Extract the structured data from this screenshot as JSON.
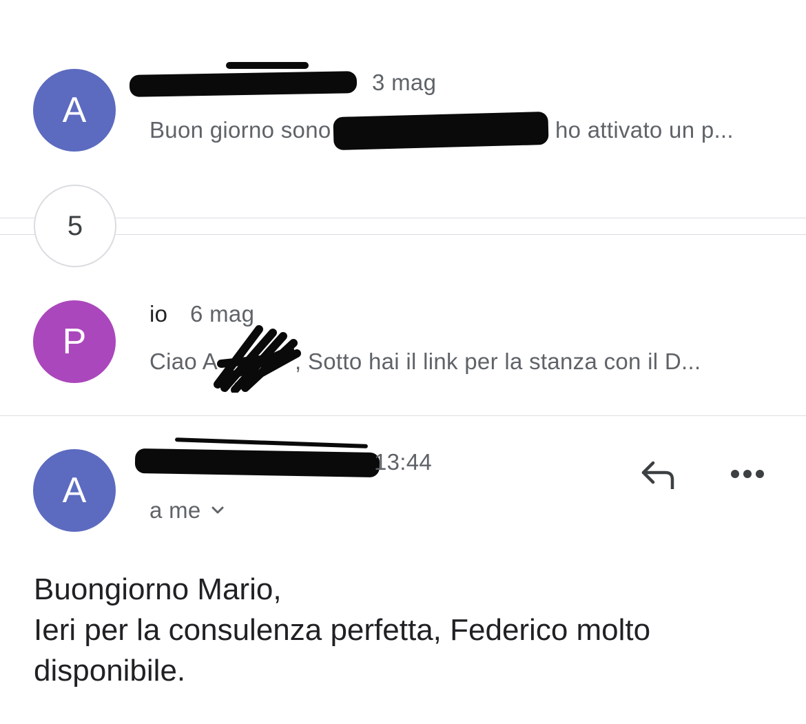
{
  "thread": {
    "messages": [
      {
        "avatar_letter": "A",
        "avatar_color": "#5c6bc0",
        "date": "3 mag",
        "snippet_start": "Buon giorno sono",
        "snippet_end": "ho attivato un p..."
      },
      {
        "avatar_letter": "P",
        "avatar_color": "#ab47bc",
        "sender": "io",
        "date": "6 mag",
        "snippet_start": "Ciao A",
        "snippet_end": ", Sotto hai il link per la stanza con il D..."
      }
    ],
    "collapsed_count": "5"
  },
  "open_message": {
    "avatar_letter": "A",
    "avatar_color": "#5c6bc0",
    "time": "13:44",
    "recipient": "a me",
    "reply_icon": "reply-icon",
    "more_icon": "more-horizontal-icon",
    "expand_icon": "chevron-down-icon",
    "body_lines": [
      "Buongiorno Mario,",
      "Ieri per la consulenza perfetta, Federico molto",
      "disponibile."
    ]
  }
}
